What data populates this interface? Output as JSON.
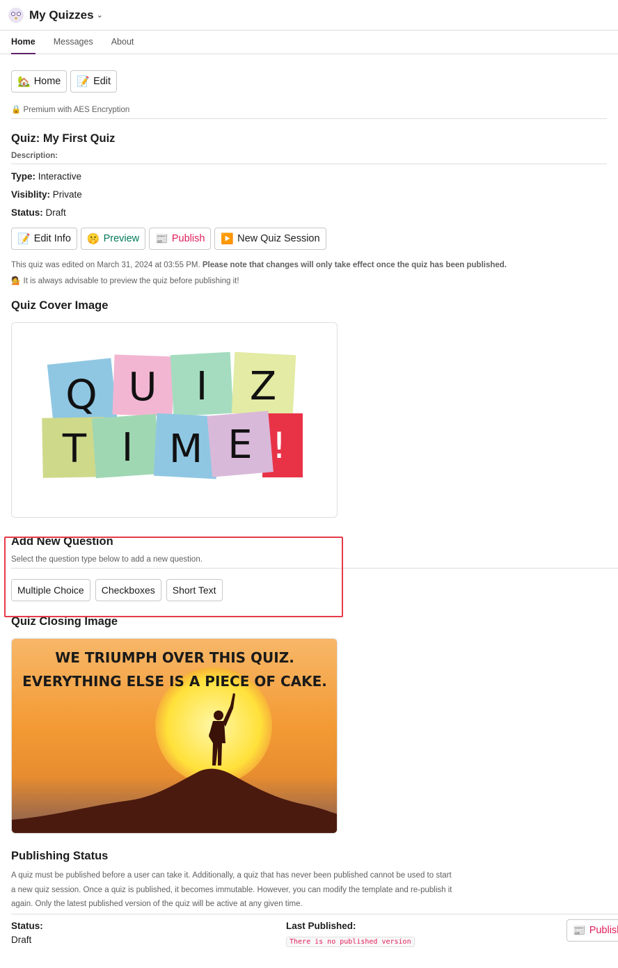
{
  "app": {
    "title": "My Quizzes"
  },
  "tabs": [
    {
      "label": "Home"
    },
    {
      "label": "Messages"
    },
    {
      "label": "About"
    }
  ],
  "nav_buttons": {
    "home": "Home",
    "edit": "Edit"
  },
  "premium_note": "Premium with AES Encryption",
  "quiz": {
    "title": "Quiz: My First Quiz",
    "description_label": "Description:",
    "type_label": "Type:",
    "type_value": "Interactive",
    "visibility_label": "Visiblity:",
    "visibility_value": "Private",
    "status_label": "Status:",
    "status_value": "Draft"
  },
  "actions": {
    "edit_info": "Edit Info",
    "preview": "Preview",
    "publish": "Publish",
    "new_session": "New Quiz Session"
  },
  "edited_note": "This quiz was edited on March 31, 2024 at 03:55 PM.",
  "edited_note_bold": "Please note that changes will only take effect once the quiz has been published.",
  "advice_note": "It is always advisable to preview the quiz before publishing it!",
  "cover": {
    "title": "Quiz Cover Image",
    "row1": [
      "Q",
      "U",
      "I",
      "Z"
    ],
    "row2": [
      "T",
      "I",
      "M",
      "E",
      "!"
    ]
  },
  "add_question": {
    "title": "Add New Question",
    "subtitle": "Select the question type below to add a new question.",
    "types": [
      "Multiple Choice",
      "Checkboxes",
      "Short Text"
    ]
  },
  "closing": {
    "title": "Quiz Closing Image",
    "line1": "WE TRIUMPH OVER THIS QUIZ.",
    "line2": "EVERYTHING ELSE IS A PIECE OF CAKE."
  },
  "publishing": {
    "title": "Publishing Status",
    "description": "A quiz must be published before a user can take it. Additionally, a quiz that has never been published cannot be used to start a new quiz session. Once a quiz is published, it becomes immutable. However, you can modify the template and re-publish it again. Only the latest published version of the quiz will be active at any given time.",
    "status_label": "Status:",
    "status_value": "Draft",
    "last_published_label": "Last Published:",
    "last_published_value": "There is no published version",
    "publish_button": "Publish"
  },
  "colors": {
    "accent_tab": "#611f69",
    "green_text": "#007a5a",
    "pink_text": "#e01e5a",
    "highlight": "#e53a48"
  }
}
